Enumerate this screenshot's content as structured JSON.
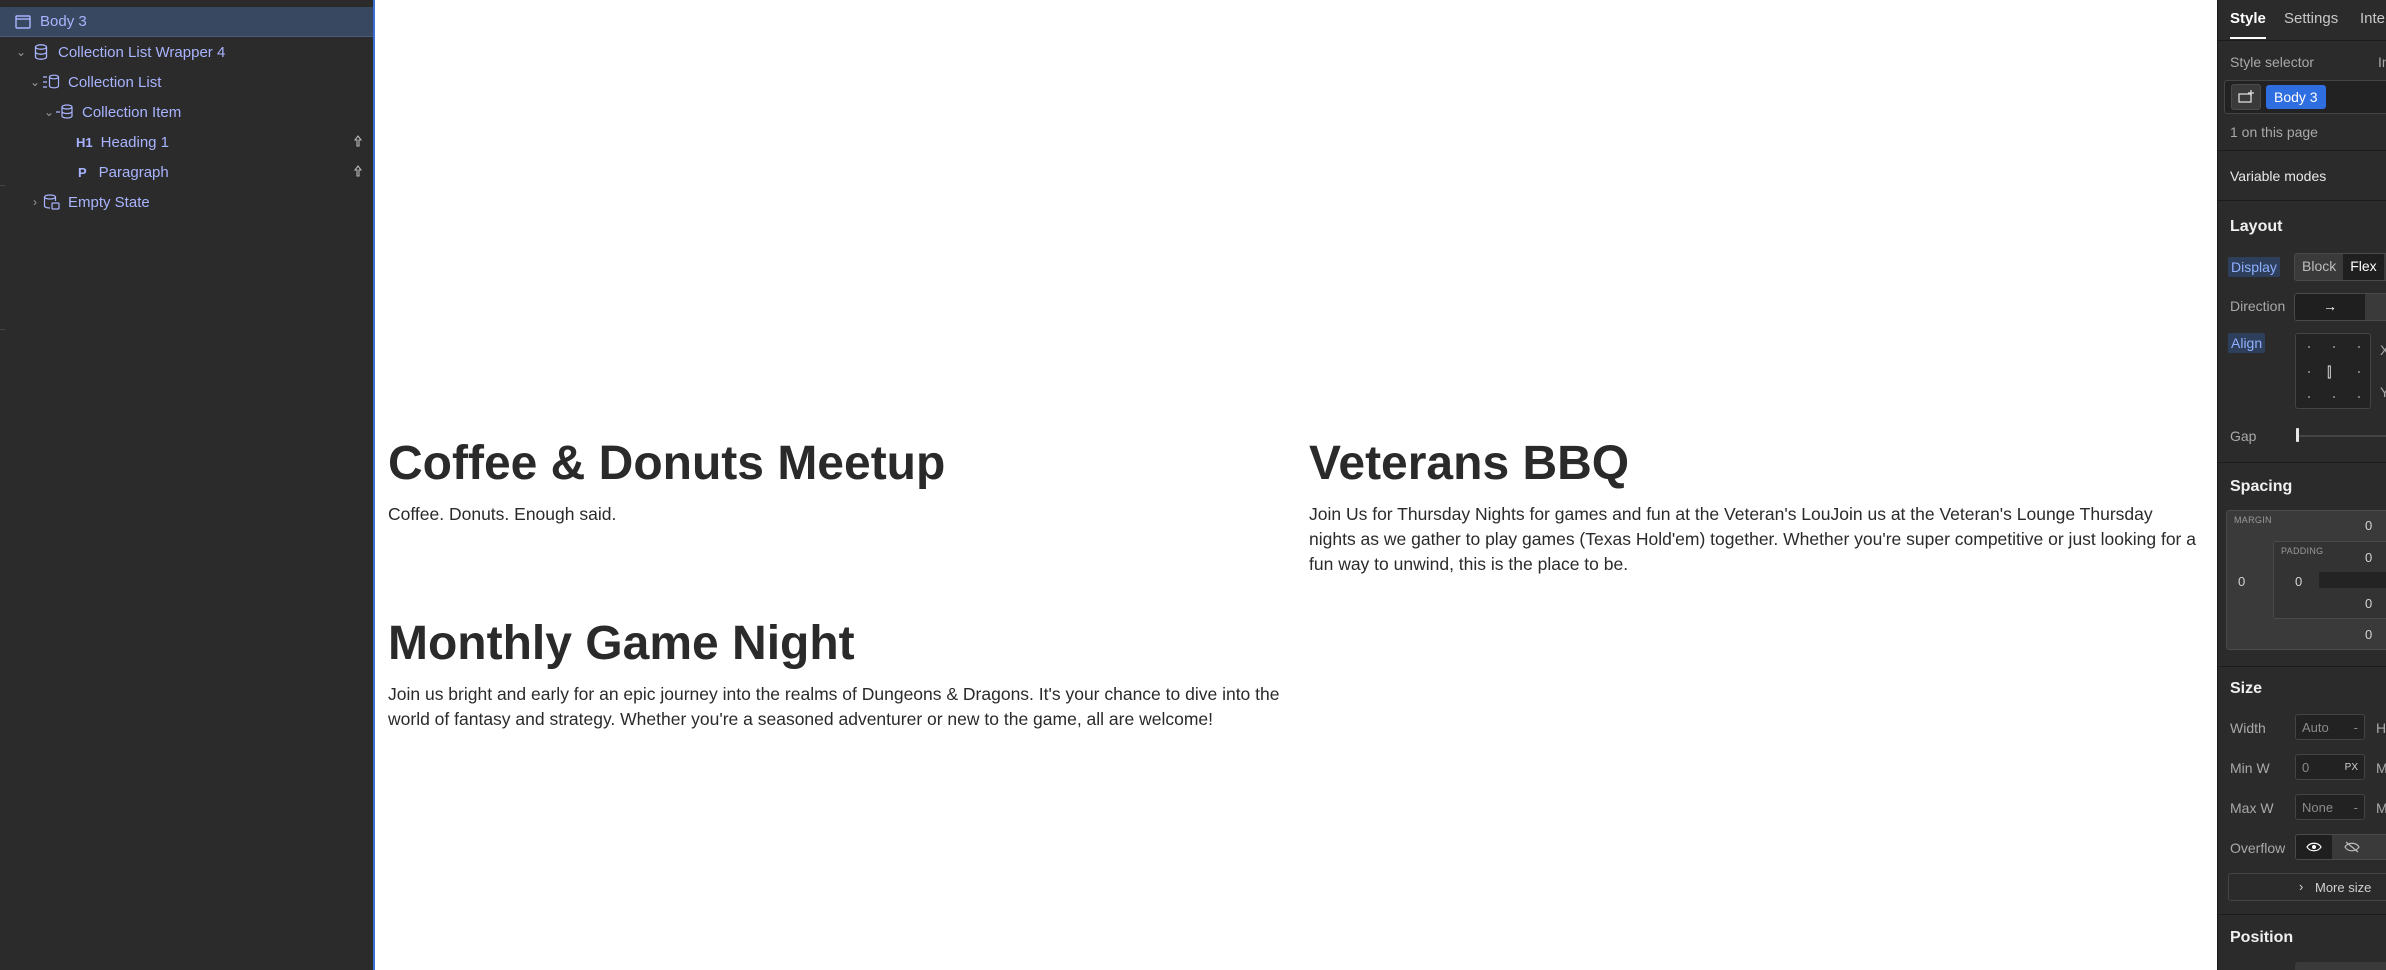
{
  "navigator": {
    "items": [
      {
        "label": "Body 3",
        "icon": "body-icon",
        "depth": 0,
        "selected": true
      },
      {
        "label": "Collection List Wrapper 4",
        "icon": "database-icon",
        "depth": 1,
        "caret": "⌄"
      },
      {
        "label": "Collection List",
        "icon": "collection-list-icon",
        "depth": 2,
        "caret": "⌄"
      },
      {
        "label": "Collection Item",
        "icon": "collection-item-icon",
        "depth": 3,
        "caret": "⌄"
      },
      {
        "label": "Heading 1",
        "tag": "H1",
        "depth": 4
      },
      {
        "label": "Paragraph",
        "tag": "P",
        "depth": 4
      },
      {
        "label": "Empty State",
        "icon": "empty-state-icon",
        "depth": 2,
        "caret": "›"
      }
    ]
  },
  "canvas": {
    "cards": [
      {
        "title": "Coffee & Donuts Meetup",
        "body": "Coffee. Donuts. Enough said."
      },
      {
        "title": "Veterans BBQ",
        "body": "Join Us for Thursday Nights for games and fun at the Veteran's LouJoin us at the Veteran's Lounge Thursday nights as we gather to play games (Texas Hold'em) together. Whether you're super competitive or just looking for a fun way to unwind, this is the place to be."
      },
      {
        "title": "Monthly Game Night",
        "body": "Join us bright and early for an epic journey into the realms of Dungeons & Dragons. It's your chance to dive into the world of fantasy and strategy. Whether you're a seasoned adventurer or new to the game, all are welcome!"
      }
    ]
  },
  "style_panel": {
    "tabs": [
      "Style",
      "Settings",
      "Inte"
    ],
    "style_selector_label": "Style selector",
    "style_selector_right": "In",
    "selector_chip": "Body 3",
    "on_page": "1 on this page",
    "variable_modes": "Variable modes",
    "layout": {
      "title": "Layout",
      "display_label": "Display",
      "display_options": [
        "Block",
        "Flex"
      ],
      "direction_label": "Direction",
      "direction_value": "→",
      "align_label": "Align",
      "align_x": "X",
      "align_y": "Y",
      "gap_label": "Gap"
    },
    "spacing": {
      "title": "Spacing",
      "margin_label": "MARGIN",
      "padding_label": "PADDING",
      "margin_top": "0",
      "margin_left": "0",
      "margin_bottom": "0",
      "padding_top": "0",
      "padding_left": "0",
      "padding_bottom": "0"
    },
    "size": {
      "title": "Size",
      "width_label": "Width",
      "width_value": "Auto",
      "height_label": "H",
      "minw_label": "Min W",
      "minw_value": "0",
      "minw_unit": "PX",
      "minh_label": "M",
      "maxw_label": "Max W",
      "maxw_value": "None",
      "maxh_label": "M",
      "overflow_label": "Overflow",
      "more_label": "More size"
    },
    "position": {
      "title": "Position"
    }
  },
  "colors": {
    "accent": "#2f6ee0",
    "navigator_bg": "#2b2b2b",
    "navigator_text": "#a8b4ff",
    "selected_row": "#394861",
    "canvas_bg": "#ffffff",
    "heading_text": "#2a2a2a"
  }
}
